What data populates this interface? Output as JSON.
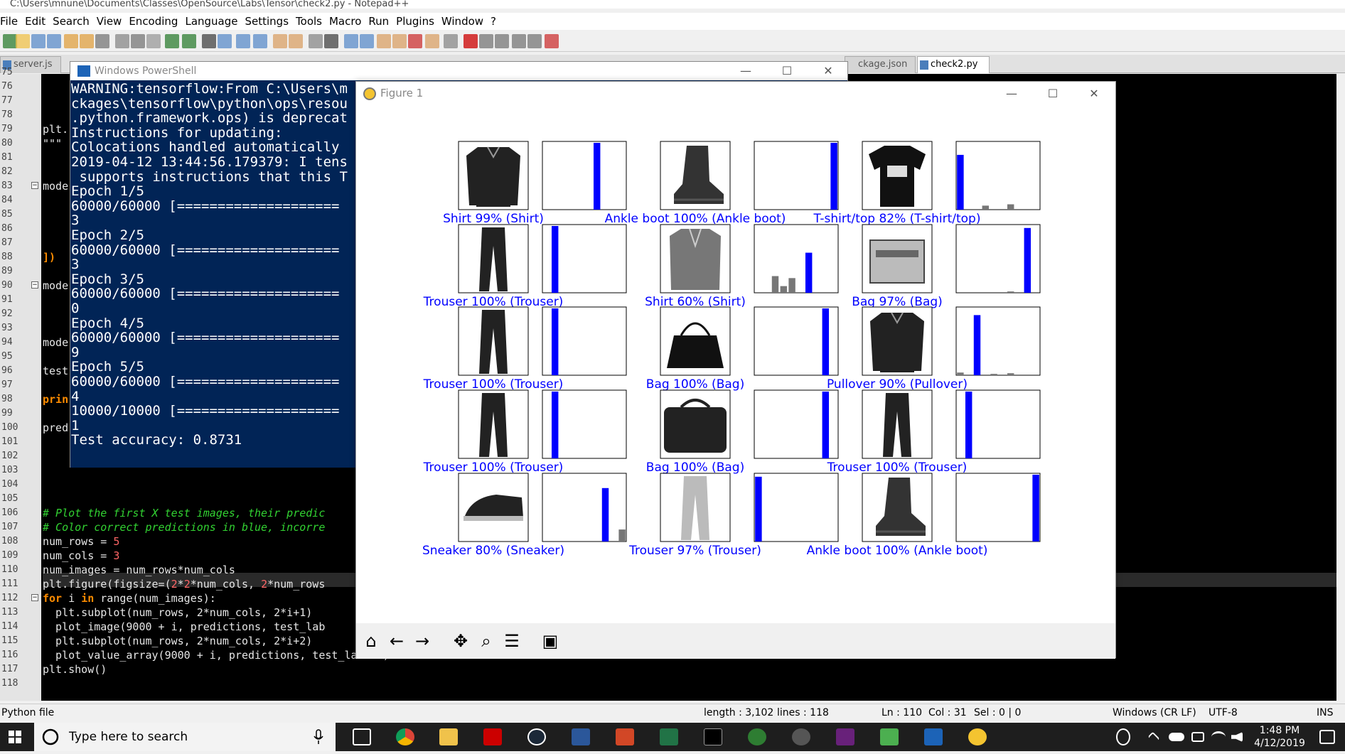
{
  "notepad": {
    "title": "C:\\Users\\mnune\\Documents\\Classes\\OpenSource\\Labs\\Tensor\\check2.py - Notepad++",
    "menu": [
      "File",
      "Edit",
      "Search",
      "View",
      "Encoding",
      "Language",
      "Settings",
      "Tools",
      "Macro",
      "Run",
      "Plugins",
      "Window",
      "?"
    ],
    "tabs": [
      {
        "label": "server.js"
      },
      {
        "label": "ckage.json"
      },
      {
        "label": "check2.py"
      }
    ],
    "line_numbers": [
      "75",
      "76",
      "77",
      "78",
      "79",
      "80",
      "81",
      "82",
      "83",
      "84",
      "85",
      "86",
      "87",
      "88",
      "89",
      "90",
      "91",
      "92",
      "93",
      "94",
      "95",
      "96",
      "97",
      "98",
      "99",
      "100",
      "101",
      "102",
      "103",
      "104",
      "105",
      "106",
      "107",
      "108",
      "109",
      "110",
      "111",
      "112",
      "113",
      "114",
      "115",
      "116",
      "117",
      "118"
    ],
    "code_fragments": {
      "l79": "plt.",
      "l80": "\"\"\"",
      "l83": "mode",
      "l88": "])",
      "l90": "mode",
      "l94": "mode",
      "l96": "test",
      "l98": "prin",
      "l100": "pred"
    },
    "code": {
      "l106": "# Plot the first X test images, their predic",
      "l107": "# Color correct predictions in blue, incorre",
      "l108a": "num_rows = ",
      "l108b": "5",
      "l109a": "num_cols = ",
      "l109b": "3",
      "l110": "num_images = num_rows*num_cols",
      "l111a": "plt.figure(figsize=(",
      "l111b": "2",
      "l111c": "*",
      "l111d": "2",
      "l111e": "*num_cols, ",
      "l111f": "2",
      "l111g": "*num_rows",
      "l112a": "for",
      "l112b": " i ",
      "l112c": "in",
      "l112d": " range(num_images):",
      "l113": "  plt.subplot(num_rows, 2*num_cols, 2*i+1)",
      "l114": "  plot_image(9000 + i, predictions, test_lab",
      "l115": "  plt.subplot(num_rows, 2*num_cols, 2*i+2)",
      "l116": "  plot_value_array(9000 + i, predictions, test_labels)",
      "l117": "plt.show()"
    },
    "status": {
      "file_type": "Python file",
      "length": "length : 3,102",
      "lines": "lines : 118",
      "ln": "Ln : 110",
      "col": "Col : 31",
      "sel": "Sel : 0 | 0",
      "eol": "Windows (CR LF)",
      "encoding": "UTF-8",
      "mode": "INS"
    }
  },
  "powershell": {
    "title": "Windows PowerShell",
    "lines": [
      "WARNING:tensorflow:From C:\\Users\\m",
      "ckages\\tensorflow\\python\\ops\\resou",
      ".python.framework.ops) is deprecat",
      "Instructions for updating:",
      "Colocations handled automatically",
      "2019-04-12 13:44:56.179379: I tens",
      " supports instructions that this T",
      "Epoch 1/5",
      "60000/60000 [====================",
      "3",
      "Epoch 2/5",
      "60000/60000 [====================",
      "3",
      "Epoch 3/5",
      "60000/60000 [====================",
      "0",
      "Epoch 4/5",
      "60000/60000 [====================",
      "9",
      "Epoch 5/5",
      "60000/60000 [====================",
      "4",
      "10000/10000 [====================",
      "1",
      "Test accuracy: 0.8731"
    ]
  },
  "figure": {
    "title": "Figure 1",
    "label_color": "#0000ff",
    "bar_color": "#0000ff",
    "bar_gray": "#777777",
    "toolbar_icons": [
      "home-icon",
      "back-icon",
      "forward-icon",
      "pan-icon",
      "zoom-icon",
      "configure-icon",
      "save-icon"
    ]
  },
  "chart_data": {
    "type": "bar",
    "panels": [
      {
        "label": "Shirt 99% (Shirt)",
        "item": "shirt",
        "values": [
          0,
          0,
          0,
          0,
          0,
          0,
          1.0,
          0,
          0,
          0
        ]
      },
      {
        "label": "Ankle boot 100% (Ankle boot)",
        "item": "boot",
        "values": [
          0,
          0,
          0,
          0,
          0,
          0,
          0,
          0,
          0,
          1.0
        ]
      },
      {
        "label": "T-shirt/top 82% (T-shirt/top)",
        "item": "tshirt",
        "values": [
          0.82,
          0,
          0,
          0.06,
          0,
          0,
          0.08,
          0,
          0,
          0
        ]
      },
      {
        "label": "Trouser 100% (Trouser)",
        "item": "trouser",
        "values": [
          0,
          1.0,
          0,
          0,
          0,
          0,
          0,
          0,
          0,
          0
        ]
      },
      {
        "label": "Shirt 60% (Shirt)",
        "item": "longshirt",
        "values": [
          0,
          0,
          0.25,
          0.1,
          0.22,
          0,
          0.6,
          0,
          0,
          0
        ]
      },
      {
        "label": "Bag 97% (Bag)",
        "item": "bag",
        "values": [
          0,
          0,
          0,
          0,
          0,
          0,
          0.02,
          0,
          0.97,
          0
        ]
      },
      {
        "label": "Trouser 100% (Trouser)",
        "item": "trouser",
        "values": [
          0,
          1.0,
          0,
          0,
          0,
          0,
          0,
          0,
          0,
          0
        ]
      },
      {
        "label": "Bag 100% (Bag)",
        "item": "tote",
        "values": [
          0,
          0,
          0,
          0,
          0,
          0,
          0,
          0,
          1.0,
          0
        ]
      },
      {
        "label": "Pullover 90% (Pullover)",
        "item": "pullover",
        "values": [
          0.04,
          0,
          0.9,
          0,
          0.02,
          0,
          0.03,
          0,
          0,
          0
        ]
      },
      {
        "label": "Trouser 100% (Trouser)",
        "item": "trouser",
        "values": [
          0,
          1.0,
          0,
          0,
          0,
          0,
          0,
          0,
          0,
          0
        ]
      },
      {
        "label": "Bag 100% (Bag)",
        "item": "handbag",
        "values": [
          0,
          0,
          0,
          0,
          0,
          0,
          0,
          0,
          1.0,
          0
        ]
      },
      {
        "label": "Trouser 100% (Trouser)",
        "item": "trouser",
        "values": [
          0,
          1.0,
          0,
          0,
          0,
          0,
          0,
          0,
          0,
          0
        ]
      },
      {
        "label": "Sneaker 80% (Sneaker)",
        "item": "sneaker",
        "values": [
          0,
          0,
          0,
          0,
          0,
          0,
          0,
          0.8,
          0,
          0.18
        ]
      },
      {
        "label": "Trouser 97% (Trouser)",
        "item": "jeans",
        "values": [
          0.97,
          0,
          0,
          0,
          0,
          0,
          0,
          0,
          0,
          0
        ]
      },
      {
        "label": "Ankle boot 100% (Ankle boot)",
        "item": "boot",
        "values": [
          0,
          0,
          0,
          0,
          0,
          0,
          0,
          0,
          0,
          1.0
        ]
      }
    ],
    "ylim": [
      0,
      1
    ],
    "num_classes": 10
  },
  "taskbar": {
    "search_placeholder": "Type here to search",
    "time": "1:48 PM",
    "date": "4/12/2019"
  }
}
